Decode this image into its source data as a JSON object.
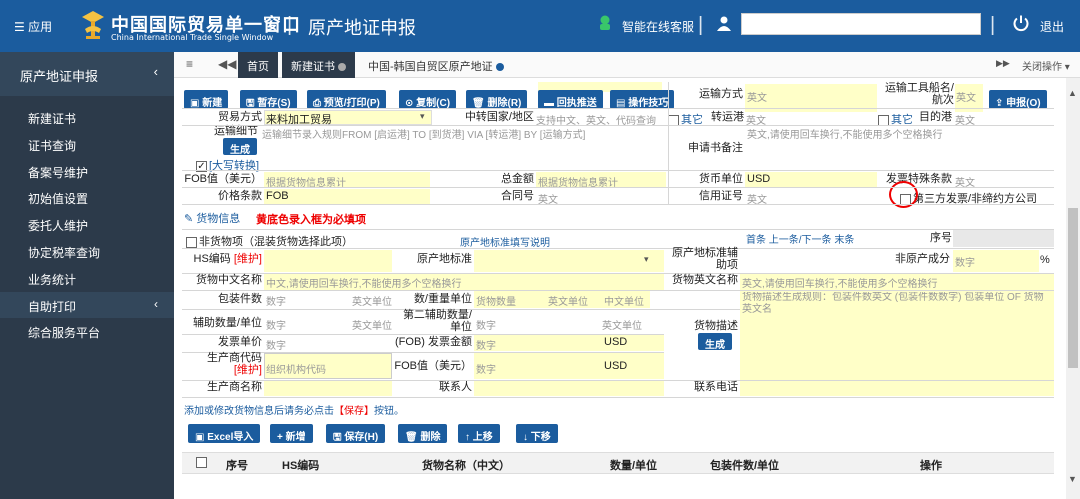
{
  "header": {
    "menu_label": "☰ 应用",
    "title_cn": "中国国际贸易单一窗口",
    "title_en": "China International Trade Single Window",
    "separator": "|",
    "page_title": "原产地证申报",
    "service_label": "智能在线客服",
    "exit_label": "退出"
  },
  "sidebar": {
    "header": "原产地证申报",
    "items": [
      {
        "label": "新建证书"
      },
      {
        "label": "证书查询"
      },
      {
        "label": "备案号维护"
      },
      {
        "label": "初始值设置"
      },
      {
        "label": "委托人维护"
      },
      {
        "label": "协定税率查询"
      },
      {
        "label": "业务统计"
      },
      {
        "label": "自助打印"
      },
      {
        "label": "综合服务平台"
      }
    ]
  },
  "tabs": {
    "items": [
      "首页",
      "新建证书",
      "中国-韩国自贸区原产地证"
    ],
    "close_ops": "关闭操作"
  },
  "toolbar": {
    "buttons": [
      "新建",
      "暂存(S)",
      "预览/打印(P)",
      "复制(C)",
      "删除(R)",
      "回执推送",
      "操作技巧"
    ],
    "submit": "申报(O)"
  },
  "form": {
    "transport_mode_label": "运输方式",
    "transport_mode_ph": "英文",
    "vessel_label": "运输工具船名/航次",
    "vessel_ph": "英文",
    "trade_mode_label": "贸易方式",
    "trade_mode_value": "来料加工贸易",
    "transit_country_label": "中转国家/地区",
    "transit_country_ph": "支持中文、英文、代码查询",
    "other_label": "其它",
    "transit_port_label": "转运港",
    "transit_port_ph": "英文",
    "other2_label": "其它",
    "dest_port_label": "目的港",
    "dest_port_ph": "英文",
    "transport_detail_label": "运输细节",
    "transport_detail_ph": "运输细节录入规则FROM [启运港] TO [到货港] VIA [转运港] BY [运输方式]",
    "generate_label": "生成",
    "uppercase_label": "[大写转换]",
    "remark_label": "申请书备注",
    "remark_ph": "英文,请使用回车换行,不能使用多个空格换行",
    "fob_label": "FOB值（美元）",
    "fob_ph": "根据货物信息累计",
    "total_label": "总金额",
    "total_ph": "根据货物信息累计",
    "currency_label": "货币单位",
    "currency_value": "USD",
    "invoice_special_label": "发票特殊条款",
    "invoice_special_ph": "英文",
    "price_term_label": "价格条款",
    "price_term_value": "FOB",
    "contract_label": "合同号",
    "contract_ph": "英文",
    "lc_label": "信用证号",
    "lc_ph": "英文",
    "third_party_label": "第三方发票/非缔约方公司"
  },
  "goods": {
    "section_title": "货物信息",
    "required_note": "黄底色录入框为必填项",
    "non_goods_label": "非货物项（混装货物选择此项）",
    "std_note": "原产地标准填写说明",
    "nav": "首条 上一条/下一条 末条",
    "seq_label": "序号",
    "hs_label": "HS编码",
    "maintain": "[维护]",
    "origin_std_label": "原产地标准",
    "origin_aux_label": "原产地标准辅助项",
    "non_origin_label": "非原产成分",
    "non_origin_ph": "数字",
    "percent": "%",
    "cn_name_label": "货物中文名称",
    "cn_name_ph": "中文,请使用回车换行,不能使用多个空格换行",
    "en_name_label": "货物英文名称",
    "en_name_ph": "英文,请使用回车换行,不能使用多个空格换行",
    "pkg_count_label": "包装件数",
    "ph_num": "数字",
    "ph_en_unit": "英文单位",
    "qty_label": "数/重量单位",
    "ph_goods_qty": "货物数量",
    "ph_cn_unit": "中文单位",
    "desc_rule": "货物描述生成规则：包装件数英文 (包装件数数字) 包装单位 OF 货物英文名",
    "aux_qty_label": "辅助数量/单位",
    "aux2_label": "第二辅助数量/单位",
    "desc_label": "货物描述",
    "generate_label": "生成",
    "invoice_price_label": "发票单价",
    "invoice_amount_label": "(FOB) 发票金额",
    "ph_num2": "数字",
    "usd": "USD",
    "manufacturer_code_label": "生产商代码",
    "manufacturer_code_ph": "组织机构代码",
    "fob_usd_label": "FOB值（美元）",
    "manufacturer_name_label": "生产商名称",
    "contact_label": "联系人",
    "phone_label": "联系电话",
    "save_note_prefix": "添加或修改货物信息后请务必点击",
    "save_note_key": "【保存】",
    "save_note_suffix": "按钮。",
    "action_buttons": [
      "Excel导入",
      "新增",
      "保存(H)",
      "删除",
      "上移",
      "下移"
    ],
    "table_headers": [
      "序号",
      "HS编码",
      "货物名称（中文）",
      "数量/单位",
      "包装件数/单位",
      "操作"
    ]
  }
}
